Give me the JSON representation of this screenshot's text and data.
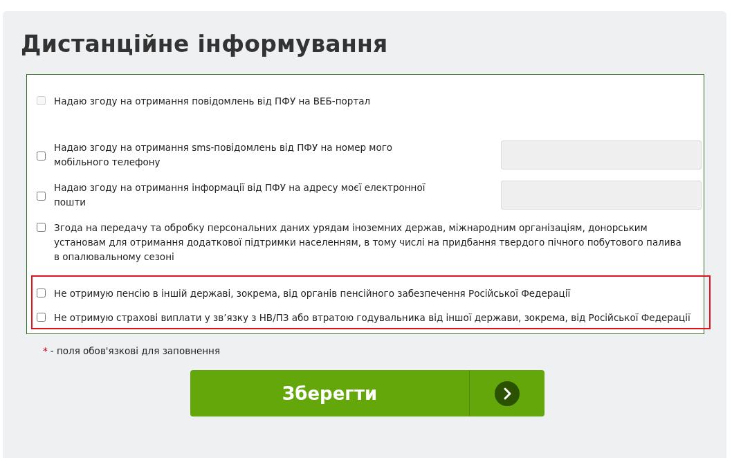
{
  "title": "Дистанційне інформування",
  "options": [
    {
      "label": "Надаю згоду на отримання повідомлень від ПФУ на ВЕБ-портал",
      "checked": false,
      "disabled": true,
      "kind": "plain"
    },
    {
      "label": "Надаю згоду на отримання sms-повідомлень від ПФУ на номер мого мобільного телефону",
      "checked": false,
      "disabled": false,
      "kind": "with-field"
    },
    {
      "label": "Надаю згоду на отримання інформації від ПФУ на адресу моєї електронної пошти",
      "checked": false,
      "disabled": false,
      "kind": "with-field"
    },
    {
      "label": "Згода на передачу та обробку персональних даних урядам іноземних держав, міжнародним організаціям, донорським установам для отримання додаткової підтримки населенням, в тому числі на придбання твердого пічного побутового палива в опалювальному сезоні",
      "checked": false,
      "disabled": false,
      "kind": "plain"
    }
  ],
  "highlighted_options": [
    {
      "label": "Не отримую пенсію в іншій державі, зокрема, від органів пенсійного забезпечення Російської Федерації",
      "checked": false,
      "disabled": false
    },
    {
      "label": "Не отримую страхові виплати у зв’язку з НВ/ПЗ або втратою годувальника від іншої держави, зокрема, від Російської Федерації",
      "checked": false,
      "disabled": false
    }
  ],
  "required_note": {
    "mark": "*",
    "text": "- поля обов'язкові для заповнення"
  },
  "save_button": {
    "label": "Зберегти"
  }
}
